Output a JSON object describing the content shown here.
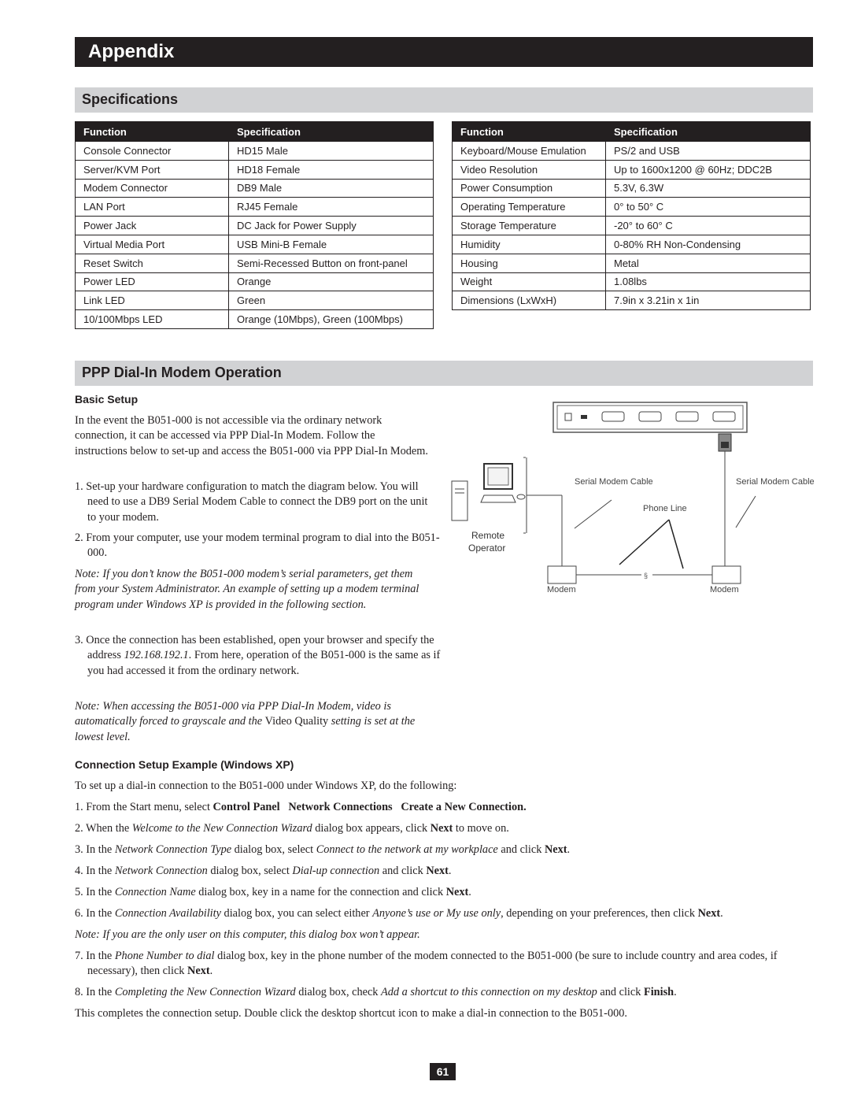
{
  "header": {
    "title": "Appendix"
  },
  "specifications": {
    "title": "Specifications",
    "columns": [
      "Function",
      "Specification"
    ],
    "left_table": [
      [
        "Console Connector",
        "HD15 Male"
      ],
      [
        "Server/KVM Port",
        "HD18 Female"
      ],
      [
        "Modem Connector",
        "DB9 Male"
      ],
      [
        "LAN Port",
        "RJ45 Female"
      ],
      [
        "Power Jack",
        "DC Jack for Power Supply"
      ],
      [
        "Virtual Media Port",
        "USB Mini-B Female"
      ],
      [
        "Reset Switch",
        "Semi-Recessed Button on front-panel"
      ],
      [
        "Power LED",
        "Orange"
      ],
      [
        "Link LED",
        "Green"
      ],
      [
        "10/100Mbps LED",
        "Orange (10Mbps), Green (100Mbps)"
      ]
    ],
    "right_table": [
      [
        "Keyboard/Mouse Emulation",
        "PS/2 and USB"
      ],
      [
        "Video Resolution",
        "Up to 1600x1200 @ 60Hz; DDC2B"
      ],
      [
        "Power Consumption",
        "5.3V, 6.3W"
      ],
      [
        "Operating Temperature",
        "0° to 50° C"
      ],
      [
        "Storage Temperature",
        "-20° to 60° C"
      ],
      [
        "Humidity",
        "0-80% RH Non-Condensing"
      ],
      [
        "Housing",
        "Metal"
      ],
      [
        "Weight",
        "1.08lbs"
      ],
      [
        "Dimensions (LxWxH)",
        "7.9in x 3.21in x 1in"
      ]
    ]
  },
  "ppp": {
    "title": "PPP Dial-In Modem Operation",
    "basic_setup": {
      "heading": "Basic Setup",
      "intro": "In the event the B051-000 is not accessible via the ordinary network connection, it can be accessed via PPP Dial-In Modem. Follow the instructions below to set-up and access the B051-000 via PPP Dial-In Modem.",
      "step1": "1. Set-up your hardware configuration to match the diagram below. You will need to use a DB9 Serial Modem Cable to connect the DB9 port on the unit to your modem.",
      "step2": "2. From your computer, use your modem terminal program to dial into the B051-000.",
      "note1": "Note: If you don’t know the B051-000 modem’s serial parameters, get them from your System Administrator. An example of setting up a modem terminal program under Windows XP is provided in the following section.",
      "step3_a": "3. Once the connection has been established, open your browser and specify the address ",
      "step3_ip": "192.168.192.1",
      "step3_b": ". From here, operation of the B051-000 is the same as if you had accessed it from the ordinary network.",
      "note2_a": "Note: When accessing the B051-000 via PPP Dial-In Modem, video is automatically forced to grayscale and the ",
      "note2_b": "Video Quality",
      "note2_c": " setting is set at the lowest level."
    },
    "diagram": {
      "label_cable_left": "Serial Modem Cable",
      "label_cable_right": "Serial Modem Cable",
      "label_phone": "Phone Line",
      "label_remote": "Remote",
      "label_operator": "Operator",
      "label_modem_left": "Modem",
      "label_modem_right": "Modem"
    },
    "connection_setup": {
      "heading": "Connection Setup Example (Windows XP)",
      "intro": "To set up a dial-in connection to the B051-000 under Windows XP, do the following:",
      "s1_a": "1. From the Start menu, select ",
      "s1_b": "Control Panel",
      "s1_c": "Network Connections",
      "s1_d": "Create a New Connection.",
      "s2_a": "2. When the ",
      "s2_b": "Welcome to the New Connection Wizard",
      "s2_c": " dialog box appears, click ",
      "s2_d": "Next",
      "s2_e": " to move on.",
      "s3_a": "3. In the ",
      "s3_b": "Network Connection Type",
      "s3_c": " dialog box, select ",
      "s3_d": "Connect to the network at my workplace",
      "s3_e": " and click ",
      "s3_f": "Next",
      "s3_g": ".",
      "s4_a": "4. In the ",
      "s4_b": "Network Connection",
      "s4_c": " dialog box, select ",
      "s4_d": "Dial-up connection",
      "s4_e": " and click ",
      "s4_f": "Next",
      "s4_g": ".",
      "s5_a": "5. In the ",
      "s5_b": "Connection Name",
      "s5_c": " dialog box, key in a name for the connection and click ",
      "s5_d": "Next",
      "s5_e": ".",
      "s6_a": "6. In the ",
      "s6_b": "Connection Availability",
      "s6_c": " dialog box, you can select either ",
      "s6_d": "Anyone’s use or My use only",
      "s6_e": ", depending on your preferences, then click ",
      "s6_f": "Next",
      "s6_g": ".",
      "note": "Note: If you are the only user on this computer, this dialog box won’t appear.",
      "s7_a": "7. In the ",
      "s7_b": "Phone Number to dial",
      "s7_c": " dialog box, key in the phone number of the modem connected to the B051-000 (be sure to include country and area codes, if necessary), then click ",
      "s7_d": "Next",
      "s7_e": ".",
      "s8_a": "8. In the ",
      "s8_b": "Completing the New Connection Wizard",
      "s8_c": " dialog box, check ",
      "s8_d": "Add a shortcut to this connection on my desktop",
      "s8_e": " and click ",
      "s8_f": "Finish",
      "s8_g": ".",
      "outro": "This completes the connection setup. Double click the desktop shortcut icon to make a dial-in connection to the B051-000."
    }
  },
  "footer": {
    "page_number": "61"
  }
}
